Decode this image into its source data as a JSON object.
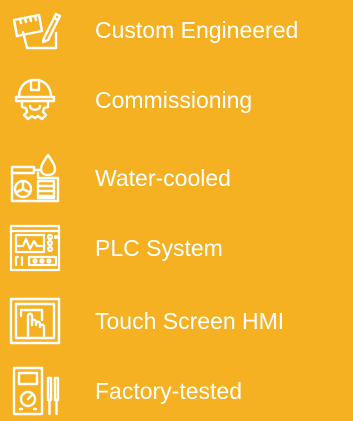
{
  "features": [
    {
      "label": "Custom Engineered",
      "icon": "ruler-pencil-design-icon"
    },
    {
      "label": "Commissioning",
      "icon": "engineer-helmet-gear-icon"
    },
    {
      "label": "Water-cooled",
      "icon": "water-cooled-chiller-icon"
    },
    {
      "label": "PLC System",
      "icon": "plc-controller-panel-icon"
    },
    {
      "label": "Touch Screen HMI",
      "icon": "touch-screen-hand-icon"
    },
    {
      "label": "Factory-tested",
      "icon": "multimeter-test-icon"
    }
  ],
  "colors": {
    "background": "#f5b122",
    "text": "#ffffff",
    "icon": "#ffffff"
  }
}
